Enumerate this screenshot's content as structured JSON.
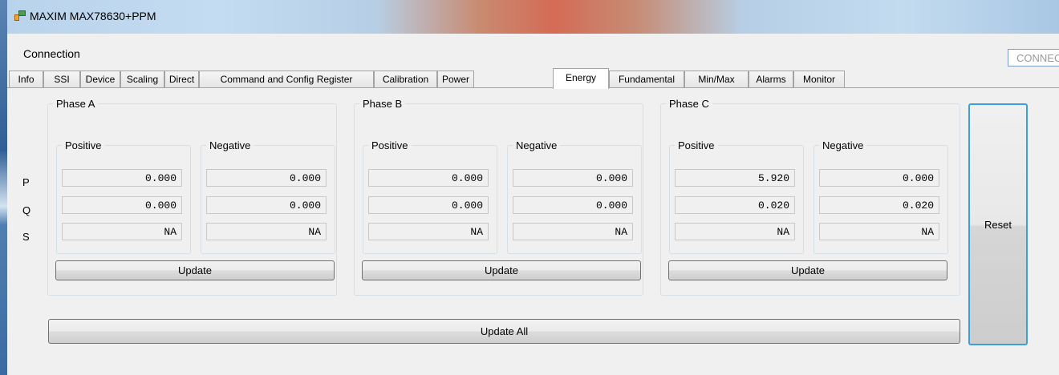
{
  "window": {
    "title": "MAXIM MAX78630+PPM"
  },
  "menu": {
    "connection_label": "Connection",
    "status_value": "CONNECTED"
  },
  "tabs": [
    {
      "label": "Info"
    },
    {
      "label": "SSI"
    },
    {
      "label": "Device"
    },
    {
      "label": "Scaling"
    },
    {
      "label": "Direct"
    },
    {
      "label": "Command and Config Register"
    },
    {
      "label": "Calibration"
    },
    {
      "label": "Power"
    },
    {
      "label": "Energy"
    },
    {
      "label": "Fundamental"
    },
    {
      "label": "Min/Max"
    },
    {
      "label": "Alarms"
    },
    {
      "label": "Monitor"
    }
  ],
  "active_tab": "Energy",
  "row_labels": {
    "p": "P",
    "q": "Q",
    "s": "S"
  },
  "phases": [
    {
      "title": "Phase A",
      "positive": {
        "label": "Positive",
        "p": "0.000",
        "q": "0.000",
        "s": "NA"
      },
      "negative": {
        "label": "Negative",
        "p": "0.000",
        "q": "0.000",
        "s": "NA"
      },
      "update_label": "Update"
    },
    {
      "title": "Phase B",
      "positive": {
        "label": "Positive",
        "p": "0.000",
        "q": "0.000",
        "s": "NA"
      },
      "negative": {
        "label": "Negative",
        "p": "0.000",
        "q": "0.000",
        "s": "NA"
      },
      "update_label": "Update"
    },
    {
      "title": "Phase C",
      "positive": {
        "label": "Positive",
        "p": "5.920",
        "q": "0.020",
        "s": "NA"
      },
      "negative": {
        "label": "Negative",
        "p": "0.000",
        "q": "0.020",
        "s": "NA"
      },
      "update_label": "Update"
    }
  ],
  "update_all_label": "Update All",
  "reset_label": "Reset"
}
